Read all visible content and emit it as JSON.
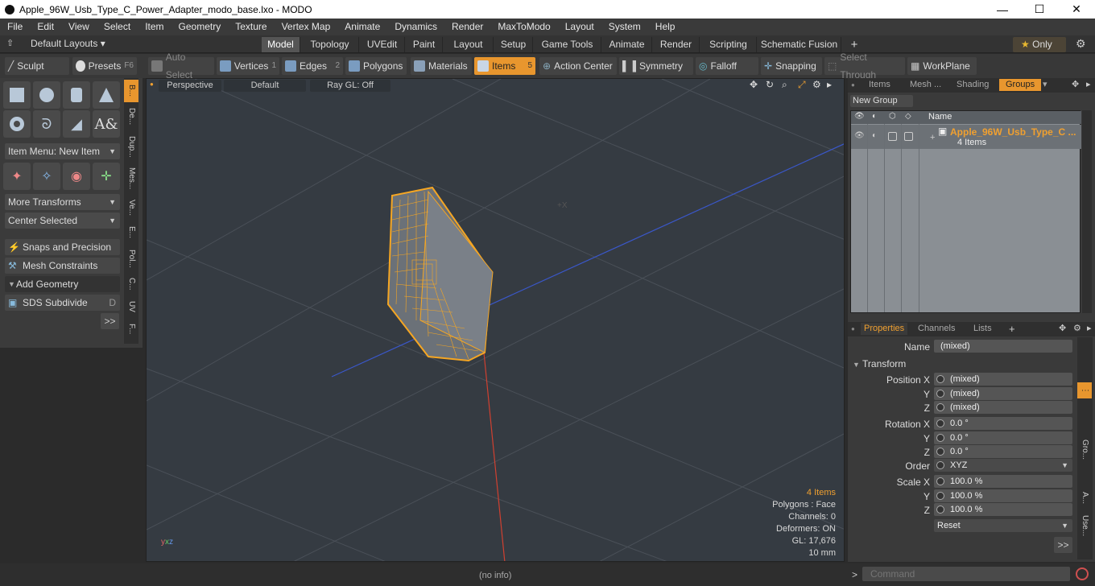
{
  "window": {
    "title": "Apple_96W_Usb_Type_C_Power_Adapter_modo_base.lxo - MODO",
    "minimize": "—",
    "maximize": "☐",
    "close": "✕"
  },
  "menu": [
    "File",
    "Edit",
    "View",
    "Select",
    "Item",
    "Geometry",
    "Texture",
    "Vertex Map",
    "Animate",
    "Dynamics",
    "Render",
    "MaxToModo",
    "Layout",
    "System",
    "Help"
  ],
  "layouts": {
    "label": "Default Layouts",
    "tabs": [
      "Model",
      "Topology",
      "UVEdit",
      "Paint",
      "Layout",
      "Setup",
      "Game Tools",
      "Animate",
      "Render",
      "Scripting",
      "Schematic Fusion"
    ],
    "add": "+",
    "only": "Only"
  },
  "toolbar": {
    "sculpt": "Sculpt",
    "presets": "Presets",
    "presets_key": "F6",
    "auto_select": "Auto Select",
    "vertices": "Vertices",
    "vertices_n": "1",
    "edges": "Edges",
    "edges_n": "2",
    "polygons": "Polygons",
    "materials": "Materials",
    "items": "Items",
    "items_n": "5",
    "action_center": "Action Center",
    "symmetry": "Symmetry",
    "falloff": "Falloff",
    "snapping": "Snapping",
    "select_through": "Select Through",
    "workplane": "WorkPlane"
  },
  "left": {
    "item_menu": "Item Menu: New Item",
    "more_transforms": "More Transforms",
    "center_selected": "Center Selected",
    "snaps": "Snaps and Precision",
    "mesh_constraints": "Mesh Constraints",
    "add_geometry": "Add Geometry",
    "sds": "SDS Subdivide",
    "sds_key": "D",
    "more": ">>"
  },
  "vtabs": [
    "B...",
    "De...",
    "Dup...",
    "Mes...",
    "Ve...",
    "E...",
    "Pol...",
    "C...",
    "UV",
    "F..."
  ],
  "viewport": {
    "view": "Perspective",
    "shading": "Default",
    "raygl": "Ray GL: Off",
    "stats": {
      "items": "4 Items",
      "polygons": "Polygons : Face",
      "channels": "Channels: 0",
      "deformers": "Deformers: ON",
      "gl": "GL: 17,676",
      "size": "10 mm"
    }
  },
  "groups": {
    "tabs": [
      "Items",
      "Mesh ...",
      "Shading",
      "Groups"
    ],
    "new_group": "New Group",
    "col_name": "Name",
    "row_name": "Apple_96W_Usb_Type_C ...",
    "row_sub": "4 Items"
  },
  "props": {
    "tabs": [
      "Properties",
      "Channels",
      "Lists"
    ],
    "add": "+",
    "name_label": "Name",
    "name_value": "(mixed)",
    "transform": "Transform",
    "pos_label": "Position X",
    "y": "Y",
    "z": "Z",
    "pos": [
      "(mixed)",
      "(mixed)",
      "(mixed)"
    ],
    "rot_label": "Rotation X",
    "rot": [
      "0.0 °",
      "0.0 °",
      "0.0 °"
    ],
    "order_label": "Order",
    "order": "XYZ",
    "scale_label": "Scale X",
    "scale": [
      "100.0 %",
      "100.0 %",
      "100.0 %"
    ],
    "reset": "Reset",
    "more": ">>",
    "side": [
      "Gro...",
      "A...",
      "Use..."
    ]
  },
  "status": {
    "info": "(no info)",
    "command_prompt": ">",
    "command_placeholder": "Command"
  },
  "colors": {
    "accent": "#f0a030",
    "selected_wire": "#f5a623"
  }
}
